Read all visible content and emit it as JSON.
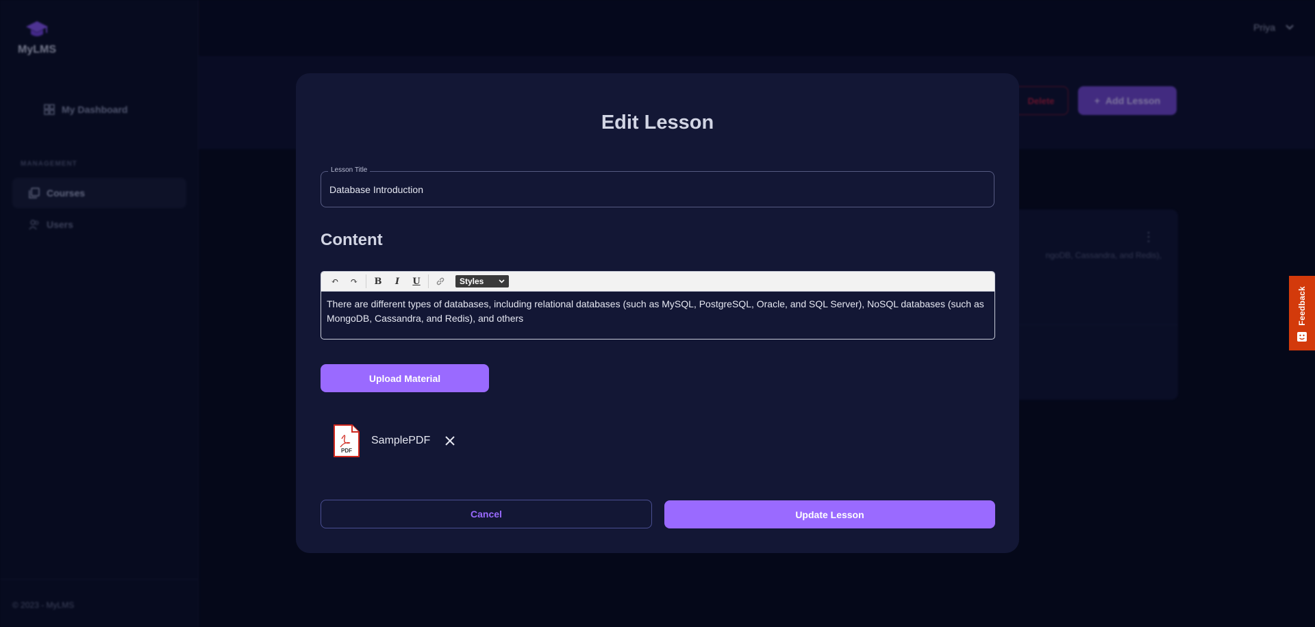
{
  "app": {
    "name": "MyLMS",
    "accent": "#9a6aff"
  },
  "sidebar": {
    "items": [
      {
        "label": "My Dashboard",
        "icon": "dashboard-icon"
      },
      {
        "label": "Courses",
        "icon": "courses-icon",
        "active": true
      },
      {
        "label": "Users",
        "icon": "users-icon"
      }
    ],
    "section_label": "MANAGEMENT",
    "footer": "© 2023 - MyLMS"
  },
  "topbar": {
    "user_name": "Priya"
  },
  "header": {
    "delete_label": "Delete",
    "add_lesson_label": "Add Lesson",
    "delete_color": "#a51c3c"
  },
  "background_card": {
    "snippet": "ngoDB, Cassandra, and Redis),"
  },
  "modal": {
    "title": "Edit Lesson",
    "lesson_title_label": "Lesson Title",
    "lesson_title_value": "Database Introduction",
    "content_heading": "Content",
    "editor": {
      "styles_label": "Styles",
      "text": "There are different types of databases, including relational databases (such as MySQL, PostgreSQL, Oracle, and SQL Server), NoSQL databases (such as MongoDB, Cassandra, and Redis), and others"
    },
    "upload_label": "Upload Material",
    "file": {
      "name": "SamplePDF",
      "type_label": "PDF"
    },
    "cancel_label": "Cancel",
    "update_label": "Update Lesson"
  },
  "feedback": {
    "label": "Feedback",
    "color": "#d33a0b"
  }
}
